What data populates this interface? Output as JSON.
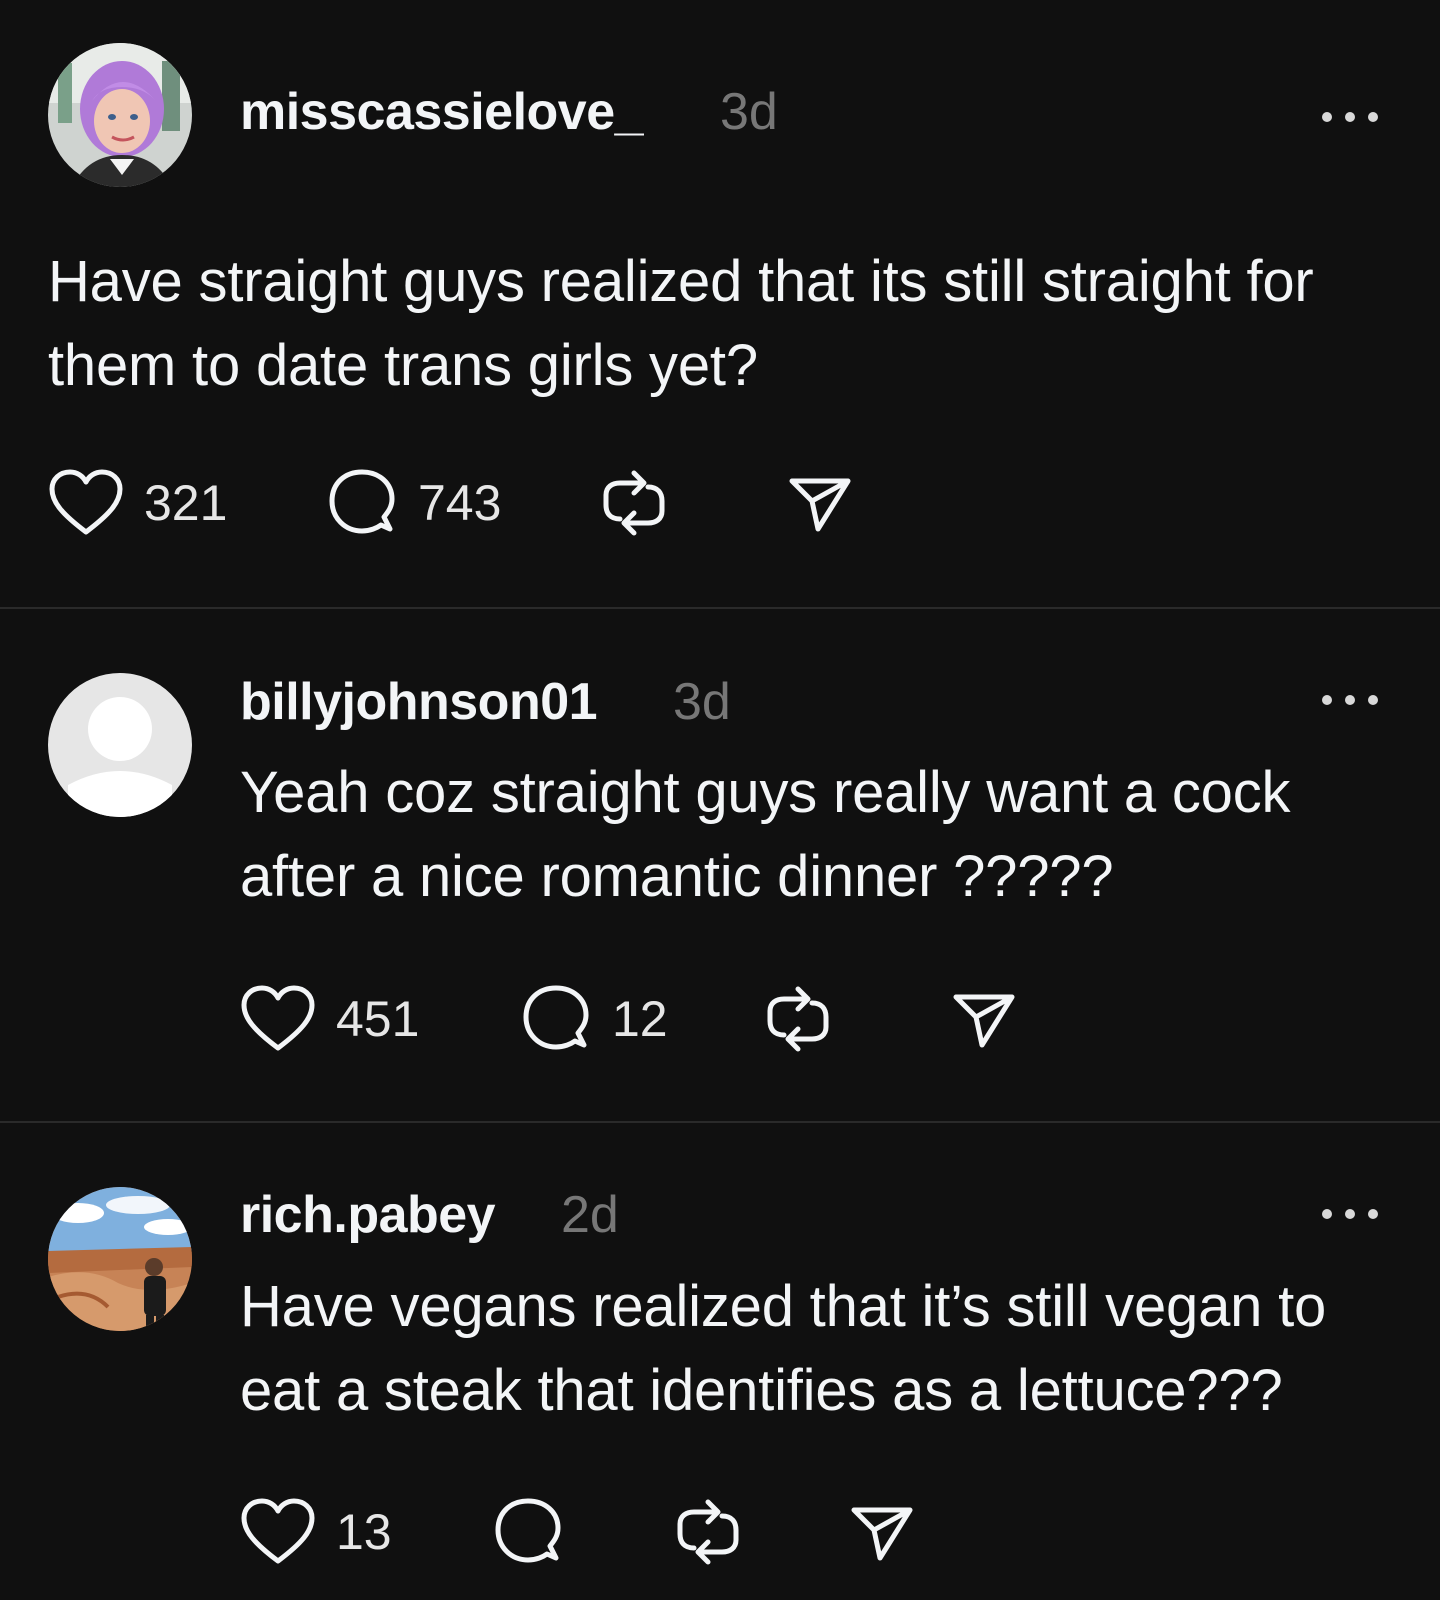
{
  "theme": {
    "background": "#101010",
    "text": "#f3f5f7",
    "muted": "#777777",
    "divider": "#2a2a2a"
  },
  "posts": [
    {
      "username": "misscassielove_",
      "time": "3d",
      "text": "Have straight guys realized that its still straight for them to date trans girls yet?",
      "likes": "321",
      "replies": "743",
      "avatar": "photo-avatar-purple-hair"
    },
    {
      "username": "billyjohnson01",
      "time": "3d",
      "text": "Yeah coz straight guys really want a cock after a nice romantic dinner ?????",
      "likes": "451",
      "replies": "12",
      "avatar": "default-avatar"
    },
    {
      "username": "rich.pabey",
      "time": "2d",
      "text": "Have vegans realized that it’s still vegan to eat a steak that identifies as a lettuce???",
      "likes": "13",
      "replies": "",
      "avatar": "photo-avatar-canyon"
    }
  ],
  "icons": {
    "like": "heart-icon",
    "reply": "comment-icon",
    "repost": "repost-icon",
    "share": "send-icon",
    "more": "more-icon"
  }
}
